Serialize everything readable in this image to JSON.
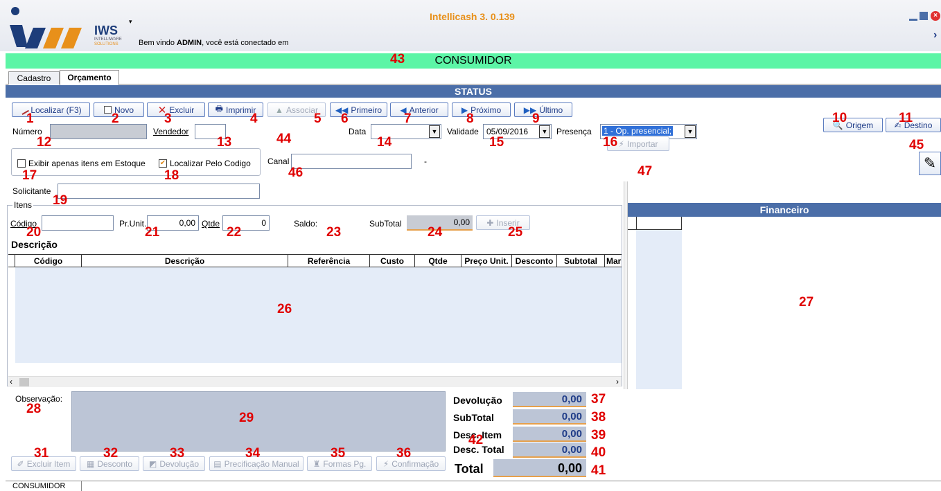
{
  "window": {
    "title": "Intellicash 3. 0.139",
    "welcome_prefix": "Bem vindo ",
    "welcome_user": "ADMIN",
    "welcome_suffix": ", você está conectado em",
    "logo_text": "IWS",
    "logo_sub1": "INTELLIWARE",
    "logo_sub2": "SOLUTIONS",
    "colors": {
      "title": "#e8901a",
      "banner": "#5cf5a6",
      "header": "#4b6ea8",
      "annotation": "#e00000"
    }
  },
  "banner": {
    "customer": "CONSUMIDOR"
  },
  "tabs": [
    {
      "label": "Cadastro"
    },
    {
      "label": "Orçamento"
    }
  ],
  "status_header": "STATUS",
  "toolbar": {
    "localizar": "Localizar (F3)",
    "novo": "Novo",
    "excluir": "Excluir",
    "imprimir": "Imprimir",
    "associar": "Associar",
    "primeiro": "Primeiro",
    "anterior": "Anterior",
    "proximo": "Próximo",
    "ultimo": "Último",
    "origem": "Origem",
    "destino": "Destino"
  },
  "form": {
    "numero_label": "Número",
    "vendedor_label": "Vendedor",
    "data_label": "Data",
    "validade_label": "Validade",
    "validade_value": "05/09/2016",
    "presenca_label": "Presença",
    "presenca_value": "1 - Op. presencial;",
    "exibir_estoque_label": "Exibir apenas itens em Estoque",
    "localizar_codigo_label": "Localizar Pelo Codigo",
    "canal_label": "Canal",
    "canal_dash": "-",
    "importar": "Importar",
    "solicitante_label": "Solicitante"
  },
  "itens": {
    "group_label": "Itens",
    "codigo_label": "Código",
    "prunit_label": "Pr.Unit.",
    "prunit_value": "0,00",
    "qtde_label": "Qtde",
    "qtde_value": "0",
    "saldo_label": "Saldo:",
    "subtotal_label": "SubTotal",
    "subtotal_value": "0,00",
    "inserir": "Inserir",
    "descricao_label": "Descrição",
    "columns": [
      "Código",
      "Descrição",
      "Referência",
      "Custo",
      "Qtde",
      "Preço Unit.",
      "Desconto",
      "Subtotal",
      "Mar"
    ]
  },
  "financeiro": {
    "title": "Financeiro"
  },
  "observacao_label": "Observação:",
  "bottom_buttons": {
    "excluir_item": "Excluir Item",
    "desconto": "Desconto",
    "devolucao": "Devolução",
    "precificacao": "Precificação Manual",
    "formas_pg": "Formas Pg.",
    "confirmacao": "Confirmação"
  },
  "totals": {
    "devolucao_label": "Devolução",
    "devolucao_value": "0,00",
    "subtotal_label": "SubTotal",
    "subtotal_value": "0,00",
    "desc_item_label": "Desc. Item",
    "desc_item_value": "0,00",
    "desc_total_label": "Desc. Total",
    "desc_total_value": "0,00",
    "total_label": "Total",
    "total_value": "0,00"
  },
  "status_tab": "CONSUMIDOR",
  "annotations": [
    "1",
    "2",
    "3",
    "4",
    "5",
    "6",
    "7",
    "8",
    "9",
    "10",
    "11",
    "12",
    "13",
    "14",
    "15",
    "16",
    "17",
    "18",
    "19",
    "20",
    "21",
    "22",
    "23",
    "24",
    "25",
    "26",
    "27",
    "28",
    "29",
    "31",
    "32",
    "33",
    "34",
    "35",
    "36",
    "37",
    "38",
    "39",
    "40",
    "41",
    "42",
    "43",
    "44",
    "45",
    "46",
    "47"
  ]
}
